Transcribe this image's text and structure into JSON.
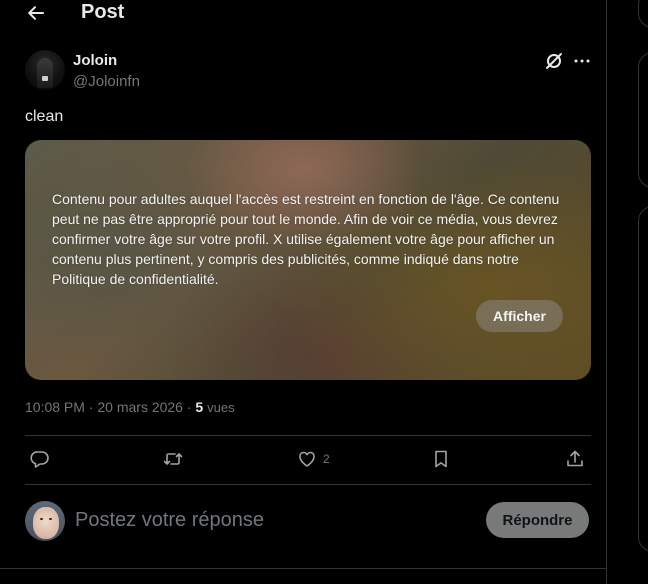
{
  "header": {
    "title": "Post"
  },
  "post": {
    "author": {
      "display_name": "Joloin",
      "handle": "@Joloinfn"
    },
    "text": "clean",
    "media": {
      "warning": "Contenu pour adultes auquel l'accès est restreint en fonction de l'âge. Ce contenu peut ne pas être approprié pour tout le monde. Afin de voir ce média, vous devrez confirmer votre âge sur votre profil. X utilise également votre âge pour afficher un contenu plus pertinent, y compris des publicités, comme indiqué dans notre Politique de confidentialité.",
      "show_label": "Afficher"
    },
    "meta": {
      "time_date": "10:08 PM · 20 mars 2026 · ",
      "views_count": "5",
      "views_label": "vues"
    },
    "actions": {
      "like_count": "2"
    }
  },
  "reply": {
    "placeholder": "Postez votre réponse",
    "button_label": "Répondre"
  },
  "icons": {
    "back": "arrow-left-icon",
    "grok": "grok-icon",
    "more": "more-icon",
    "reply": "reply-icon",
    "retweet": "retweet-icon",
    "like": "heart-icon",
    "bookmark": "bookmark-icon",
    "share": "share-icon"
  },
  "colors": {
    "background": "#000000",
    "text": "#e7e9ea",
    "muted": "#71767b",
    "border": "#2f3336",
    "reply_button": "#787a7a"
  }
}
